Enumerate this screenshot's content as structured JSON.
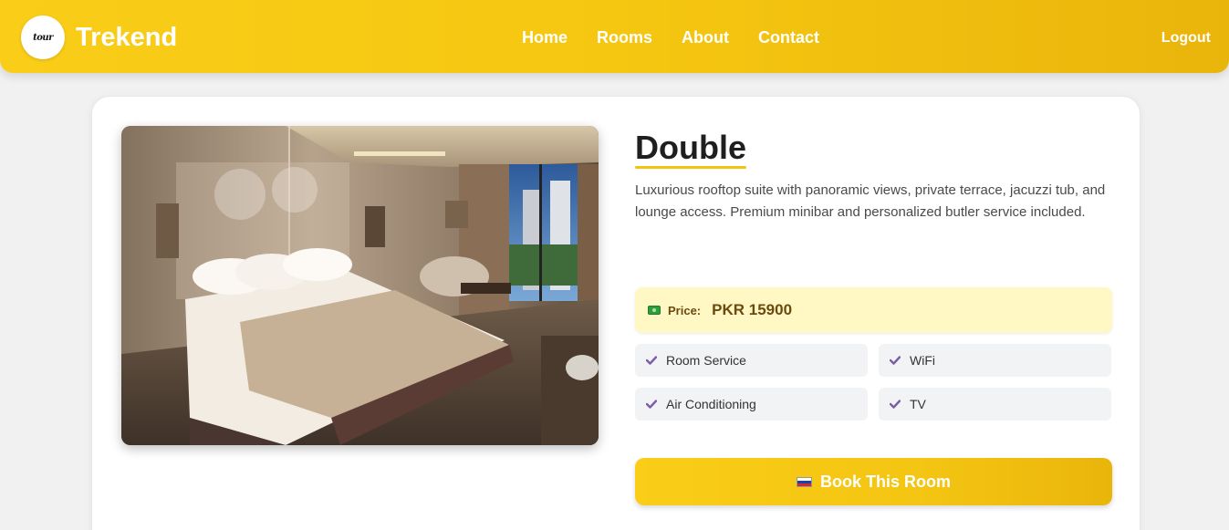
{
  "navbar": {
    "logo_text": "tour",
    "brand": "Trekend",
    "links": [
      "Home",
      "Rooms",
      "About",
      "Contact"
    ],
    "logout": "Logout"
  },
  "room": {
    "title": "Double",
    "description": "Luxurious rooftop suite with panoramic views, private terrace, jacuzzi tub, and lounge access. Premium minibar and personalized butler service included.",
    "price_icon": "money-icon",
    "price_label": "Price:",
    "price_value": "PKR 15900",
    "amenities": [
      "Room Service",
      "WiFi",
      "Air Conditioning",
      "TV"
    ],
    "book_icon": "flag-icon",
    "book_label": "Book This Room"
  },
  "colors": {
    "accent": "#f5c711",
    "price_bg": "#fff8c4",
    "check": "#7b5ea7"
  }
}
